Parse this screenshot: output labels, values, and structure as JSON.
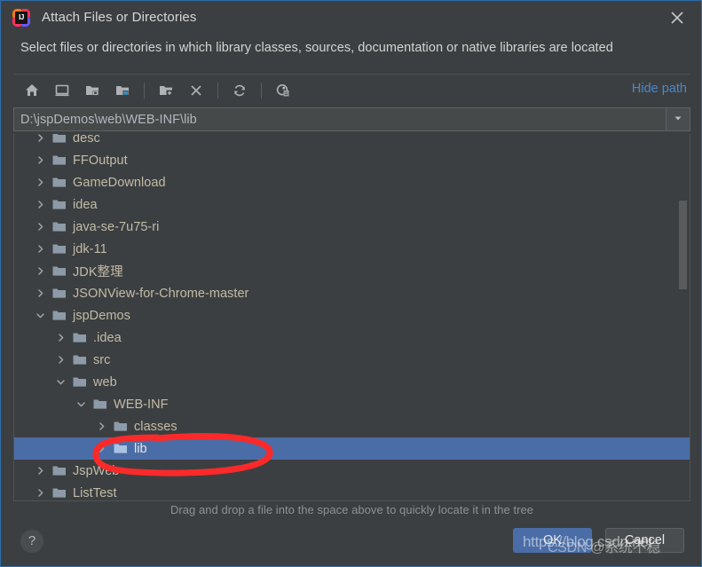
{
  "window": {
    "title": "Attach Files or Directories",
    "app_icon": "intellij-idea-icon",
    "close_icon": "close-icon",
    "subtitle": "Select files or directories in which library classes, sources, documentation or native libraries are located"
  },
  "toolbar": {
    "buttons": [
      {
        "name": "home-icon",
        "tooltip": "Home"
      },
      {
        "name": "desktop-icon",
        "tooltip": "Desktop"
      },
      {
        "name": "project-folder-icon",
        "tooltip": "Project Directory"
      },
      {
        "name": "module-folder-icon",
        "tooltip": "Module Directory"
      },
      {
        "name": "new-folder-icon",
        "tooltip": "New Folder"
      },
      {
        "name": "delete-icon",
        "tooltip": "Delete"
      },
      {
        "name": "refresh-icon",
        "tooltip": "Refresh"
      },
      {
        "name": "show-hidden-files-icon",
        "tooltip": "Show Hidden Files and Directories"
      }
    ],
    "hide_path_label": "Hide path"
  },
  "path_field": {
    "value": "D:\\jspDemos\\web\\WEB-INF\\lib",
    "placeholder": "",
    "dropdown_icon": "chevron-down-icon"
  },
  "tree": {
    "rows": [
      {
        "label": "desc",
        "indent": 0,
        "state": "collapsed",
        "selected": false
      },
      {
        "label": "FFOutput",
        "indent": 0,
        "state": "collapsed",
        "selected": false
      },
      {
        "label": "GameDownload",
        "indent": 0,
        "state": "collapsed",
        "selected": false
      },
      {
        "label": "idea",
        "indent": 0,
        "state": "collapsed",
        "selected": false
      },
      {
        "label": "java-se-7u75-ri",
        "indent": 0,
        "state": "collapsed",
        "selected": false
      },
      {
        "label": "jdk-11",
        "indent": 0,
        "state": "collapsed",
        "selected": false
      },
      {
        "label": "JDK整理",
        "indent": 0,
        "state": "collapsed",
        "selected": false
      },
      {
        "label": "JSONView-for-Chrome-master",
        "indent": 0,
        "state": "collapsed",
        "selected": false
      },
      {
        "label": "jspDemos",
        "indent": 0,
        "state": "expanded",
        "selected": false
      },
      {
        "label": ".idea",
        "indent": 1,
        "state": "collapsed",
        "selected": false
      },
      {
        "label": "src",
        "indent": 1,
        "state": "collapsed",
        "selected": false
      },
      {
        "label": "web",
        "indent": 1,
        "state": "expanded",
        "selected": false
      },
      {
        "label": "WEB-INF",
        "indent": 2,
        "state": "expanded",
        "selected": false
      },
      {
        "label": "classes",
        "indent": 3,
        "state": "collapsed",
        "selected": false
      },
      {
        "label": "lib",
        "indent": 3,
        "state": "collapsed",
        "selected": true
      },
      {
        "label": "JspWeb",
        "indent": 0,
        "state": "collapsed",
        "selected": false
      },
      {
        "label": "ListTest",
        "indent": 0,
        "state": "collapsed",
        "selected": false
      }
    ],
    "scrollbar": {
      "name": "vertical-scrollbar"
    }
  },
  "annotation": {
    "name": "red-ellipse-highlight",
    "color": "#fa2a2a",
    "target": "lib"
  },
  "hint": "Drag and drop a file into the space above to quickly locate it in the tree",
  "footer": {
    "help_label": "?",
    "ok_label": "OK",
    "cancel_label": "Cancel"
  },
  "watermark": {
    "line1": "CSDN @系统不稳",
    "line2": "https://blog.csdn.net"
  },
  "colors": {
    "dialog_bg": "#3c3f41",
    "selection": "#4a6da7",
    "link": "#4e87c7",
    "folder": "#8d9ba8",
    "text": "#c2bba7",
    "annotation": "#fa2a2a"
  }
}
